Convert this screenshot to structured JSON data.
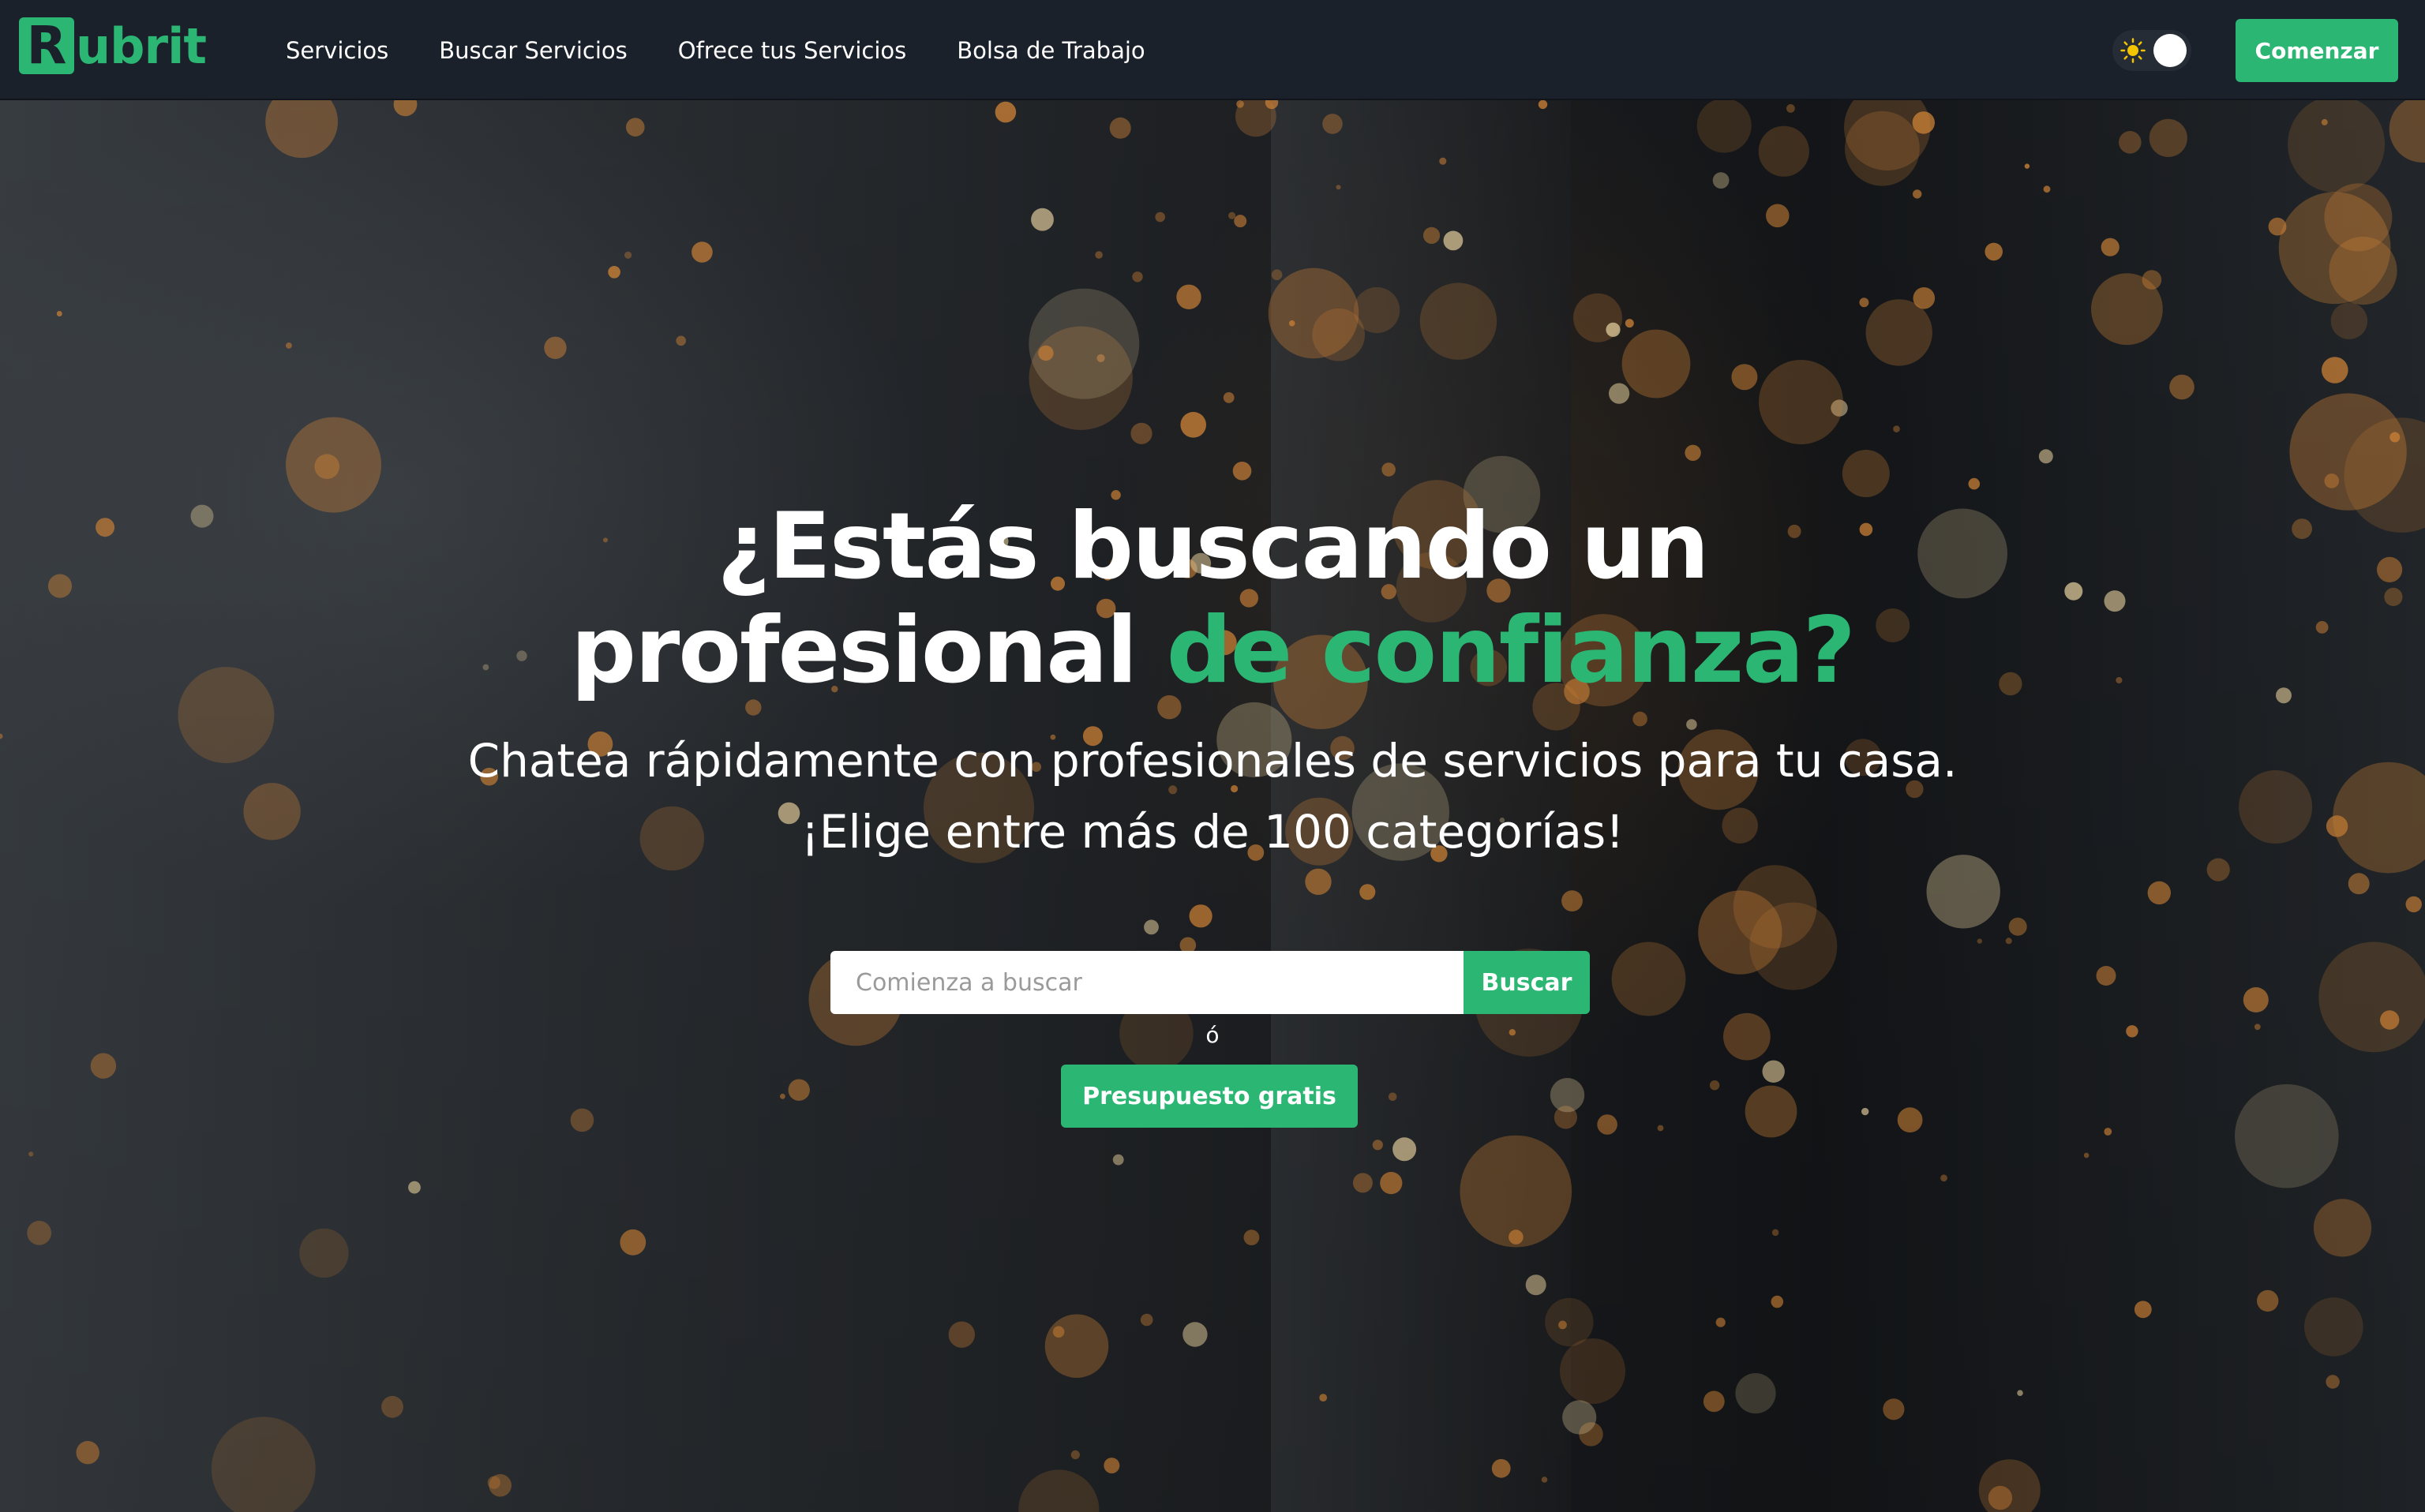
{
  "brand": {
    "logo_letter": "R",
    "logo_rest": "ubrit",
    "accent_color": "#2bb673",
    "nav_background": "#1b212b"
  },
  "nav": {
    "links": [
      "Servicios",
      "Buscar Servicios",
      "Ofrece tus Servicios",
      "Bolsa de Trabajo"
    ],
    "theme_toggle": {
      "icon": "sun-icon",
      "state": "light"
    },
    "start_label": "Comenzar"
  },
  "hero": {
    "title_line1": "¿Estás buscando un",
    "title_line2_plain": "profesional ",
    "title_line2_accent": "de confianza?",
    "subtitle_line1": "Chatea rápidamente con profesionales de servicios para tu casa.",
    "subtitle_line2": "¡Elige entre más de 100 categorías!",
    "search": {
      "placeholder": "Comienza a buscar",
      "value": "",
      "button_label": "Buscar"
    },
    "or_text": "ó",
    "quote_button_label": "Presupuesto gratis"
  }
}
